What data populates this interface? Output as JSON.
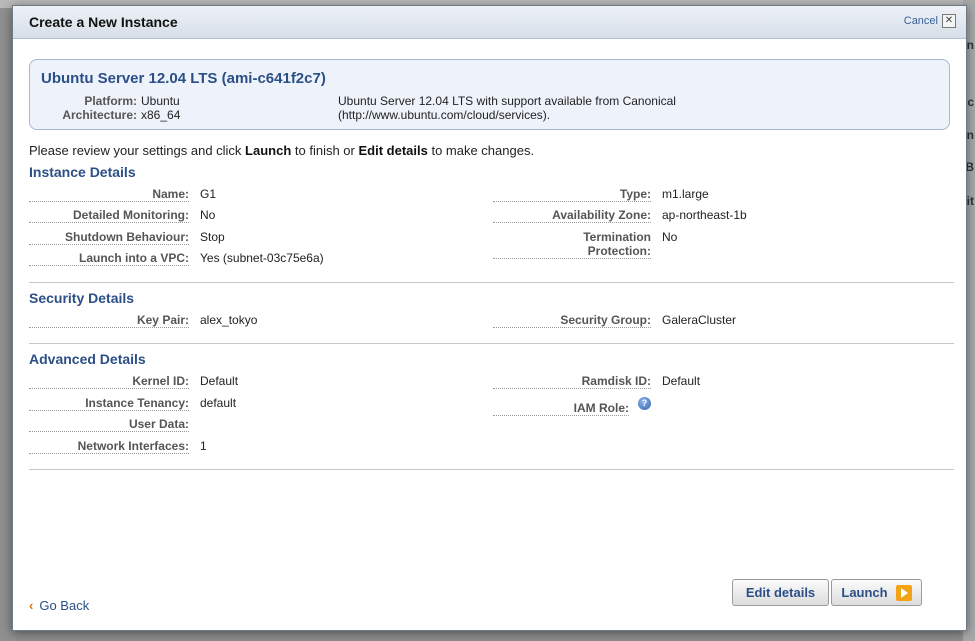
{
  "modal": {
    "title": "Create a New Instance",
    "cancel_label": "Cancel",
    "cancel_x": "✕"
  },
  "ami": {
    "title": "Ubuntu Server 12.04 LTS (ami-c641f2c7)",
    "platform_label": "Platform:",
    "platform_value": "Ubuntu",
    "arch_label": "Architecture:",
    "arch_value": "x86_64",
    "description_line1": "Ubuntu Server 12.04 LTS with support available from Canonical",
    "description_line2": "(http://www.ubuntu.com/cloud/services)."
  },
  "review": {
    "prefix": "Please review your settings and click ",
    "launch_word": "Launch",
    "middle": " to finish or ",
    "edit_word": "Edit details",
    "suffix": " to make changes."
  },
  "instance": {
    "heading": "Instance Details",
    "name_label": "Name:",
    "name_value": "G1",
    "monitoring_label": "Detailed Monitoring:",
    "monitoring_value": "No",
    "shutdown_label": "Shutdown Behaviour:",
    "shutdown_value": "Stop",
    "vpc_label": "Launch into a VPC:",
    "vpc_value": "Yes (subnet-03c75e6a)",
    "type_label": "Type:",
    "type_value": "m1.large",
    "zone_label": "Availability Zone:",
    "zone_value": "ap-northeast-1b",
    "termination_label_1": "Termination",
    "termination_label_2": "Protection:",
    "termination_value": "No"
  },
  "security": {
    "heading": "Security Details",
    "keypair_label": "Key Pair:",
    "keypair_value": "alex_tokyo",
    "group_label": "Security Group:",
    "group_value": "GaleraCluster"
  },
  "advanced": {
    "heading": "Advanced Details",
    "kernel_label": "Kernel ID:",
    "kernel_value": "Default",
    "tenancy_label": "Instance Tenancy:",
    "tenancy_value": "default",
    "userdata_label": "User Data:",
    "netif_label": "Network Interfaces:",
    "netif_value": "1",
    "ramdisk_label": "Ramdisk ID:",
    "ramdisk_value": "Default",
    "iam_label": "IAM Role:",
    "iam_help": "?"
  },
  "footer": {
    "go_back_chevron": "‹",
    "go_back_label": "Go Back",
    "edit_button": "Edit details",
    "launch_button": "Launch"
  },
  "background": {
    "right_letters": [
      "n",
      "c",
      "n",
      "B",
      "it"
    ]
  },
  "colors": {
    "accent_blue": "#2b4f86",
    "launch_orange": "#f2a316"
  }
}
